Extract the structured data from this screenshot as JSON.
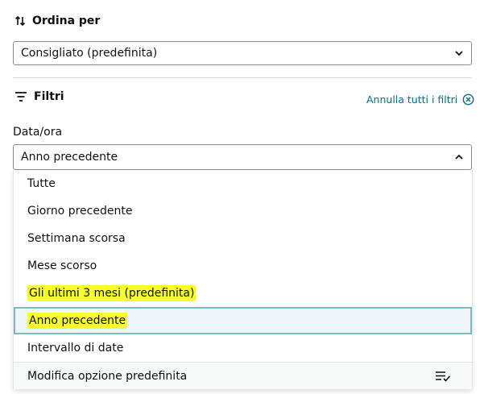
{
  "sort": {
    "icon": "sort-arrows-icon",
    "title": "Ordina per",
    "selected": "Consigliato (predefinita)"
  },
  "filters": {
    "icon": "filter-icon",
    "title": "Filtri",
    "clear_all": "Annulla tutti i filtri",
    "clear_icon": "close-circle-icon"
  },
  "date_filter": {
    "label": "Data/ora",
    "selected": "Anno precedente",
    "options": [
      {
        "label": "Tutte"
      },
      {
        "label": "Giorno precedente"
      },
      {
        "label": "Settimana scorsa"
      },
      {
        "label": "Mese scorso"
      },
      {
        "label": "Gli ultimi 3 mesi (predefinita)",
        "highlighted": true
      },
      {
        "label": "Anno precedente",
        "selected": true,
        "highlighted": true
      },
      {
        "label": "Intervallo di date"
      }
    ],
    "footer": {
      "label": "Modifica opzione predefinita",
      "icon": "list-check-icon"
    }
  },
  "colors": {
    "accent_link": "#007185",
    "highlight": "#f8ff2e",
    "selected_bg": "#edf7f9",
    "selected_border": "#84b6bd"
  }
}
